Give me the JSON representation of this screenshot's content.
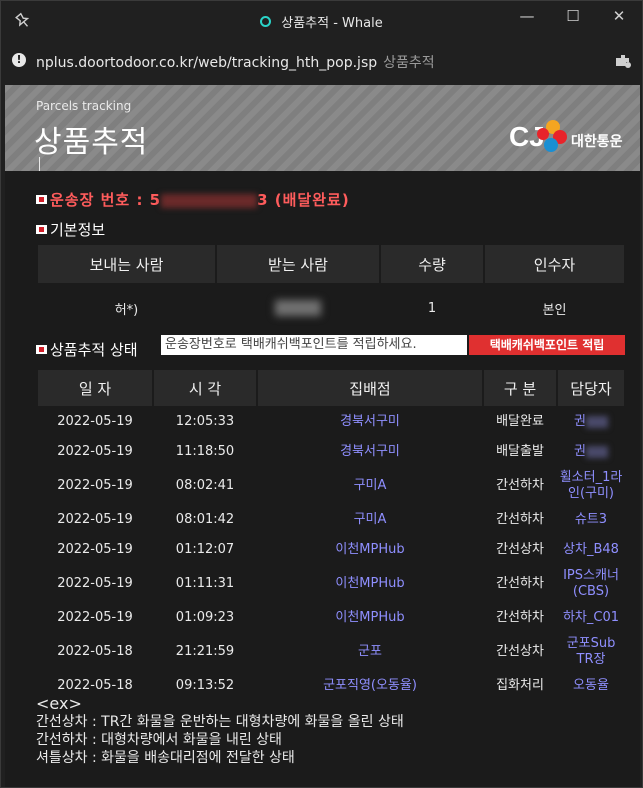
{
  "window": {
    "title": "상품추적 - Whale",
    "controls": [
      "—",
      "☐",
      "✕"
    ]
  },
  "address": {
    "url": "nplus.doortodoor.co.kr/web/tracking_hth_pop.jsp",
    "page_title": "상품추적"
  },
  "banner": {
    "subtitle": "Parcels tracking",
    "title": "상품추적",
    "logo_mark": "CJ",
    "logo_brand": "대한통운"
  },
  "waybill": {
    "label": "운송장 번호 : 5",
    "suffix": "3 (배달완료)"
  },
  "basic_info": {
    "heading": "기본정보",
    "headers": [
      "보내는 사람",
      "받는 사람",
      "수량",
      "인수자"
    ],
    "sender": "허*)",
    "quantity": "1",
    "acceptor": "본인"
  },
  "tracking": {
    "heading": "상품추적 상태",
    "points_placeholder": "운송장번호로 택배캐쉬백포인트를 적립하세요.",
    "points_button": "택배캐쉬백포인트 적립",
    "headers": [
      "일 자",
      "시 각",
      "집배점",
      "구 분",
      "담당자"
    ],
    "rows": [
      {
        "date": "2022-05-19",
        "time": "12:05:33",
        "branch": "경북서구미",
        "status": "배달완료",
        "handler": "권"
      },
      {
        "date": "2022-05-19",
        "time": "11:18:50",
        "branch": "경북서구미",
        "status": "배달출발",
        "handler": "권"
      },
      {
        "date": "2022-05-19",
        "time": "08:02:41",
        "branch": "구미A",
        "status": "간선하차",
        "handler": "휠소터_1라인(구미)"
      },
      {
        "date": "2022-05-19",
        "time": "08:01:42",
        "branch": "구미A",
        "status": "간선하차",
        "handler": "슈트3"
      },
      {
        "date": "2022-05-19",
        "time": "01:12:07",
        "branch": "이천MPHub",
        "status": "간선상차",
        "handler": "상차_B48"
      },
      {
        "date": "2022-05-19",
        "time": "01:11:31",
        "branch": "이천MPHub",
        "status": "간선하차",
        "handler": "IPS스캐너(CBS)"
      },
      {
        "date": "2022-05-19",
        "time": "01:09:23",
        "branch": "이천MPHub",
        "status": "간선하차",
        "handler": "하차_C01"
      },
      {
        "date": "2022-05-18",
        "time": "21:21:59",
        "branch": "군포",
        "status": "간선상차",
        "handler": "군포Sub TR장"
      },
      {
        "date": "2022-05-18",
        "time": "09:13:52",
        "branch": "군포직영(오동율)",
        "status": "집화처리",
        "handler": "오동율"
      }
    ]
  },
  "notes": {
    "title": "<ex>",
    "lines": [
      "간선상차 : TR간 화물을 운반하는 대형차량에 화물을 올린 상태",
      "간선하차 : 대형차량에서 화물을 내린 상태",
      "셔틀상차 : 화물을 배송대리점에 전달한 상태"
    ]
  }
}
